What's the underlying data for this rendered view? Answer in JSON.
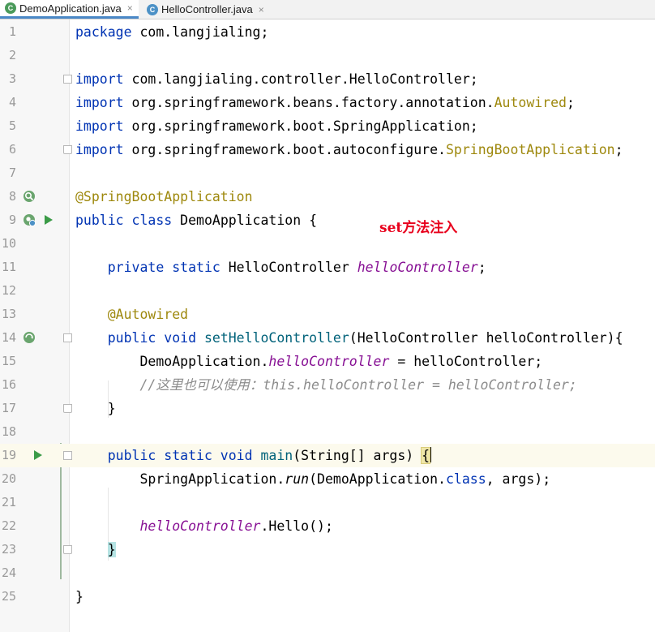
{
  "tabs": [
    {
      "label": "DemoApplication.java",
      "icon": "spring-class-icon",
      "active": true
    },
    {
      "label": "HelloController.java",
      "icon": "class-icon",
      "active": false
    }
  ],
  "tab_close_glyph": "×",
  "overlay_note": "set方法注入",
  "lines": {
    "l1": {
      "n": "1",
      "t1": "package",
      "t2": " com.langjialing;"
    },
    "l2": {
      "n": "2"
    },
    "l3": {
      "n": "3",
      "t1": "import",
      "t2": " com.langjialing.controller.HelloController;"
    },
    "l4": {
      "n": "4",
      "t1": "import",
      "t2": " org.springframework.beans.factory.annotation.",
      "t3": "Autowired",
      "t4": ";"
    },
    "l5": {
      "n": "5",
      "t1": "import",
      "t2": " org.springframework.boot.SpringApplication;"
    },
    "l6": {
      "n": "6",
      "t1": "import",
      "t2": " org.springframework.boot.autoconfigure.",
      "t3": "SpringBootApplication",
      "t4": ";"
    },
    "l7": {
      "n": "7"
    },
    "l8": {
      "n": "8",
      "t1": "@SpringBootApplication"
    },
    "l9": {
      "n": "9",
      "t1": "public class",
      "t2": " DemoApplication {"
    },
    "l10": {
      "n": "10"
    },
    "l11": {
      "n": "11",
      "t1": "    private static",
      "t2": " HelloController ",
      "t3": "helloController",
      "t4": ";"
    },
    "l12": {
      "n": "12"
    },
    "l13": {
      "n": "13",
      "t1": "    @Autowired"
    },
    "l14": {
      "n": "14",
      "t1": "    public void",
      "t2": " setHelloController",
      "t3": "(HelloController helloController){"
    },
    "l15": {
      "n": "15",
      "t1": "        DemoApplication.",
      "t2": "helloController",
      "t3": " = helloController;"
    },
    "l16": {
      "n": "16",
      "t1": "        //这里也可以使用：this.helloController = helloController;"
    },
    "l17": {
      "n": "17",
      "t1": "    }"
    },
    "l18": {
      "n": "18"
    },
    "l19": {
      "n": "19",
      "t1": "    public static void",
      "t2": " main",
      "t3": "(String[] args) ",
      "t4": "{"
    },
    "l20": {
      "n": "20",
      "t1": "        SpringApplication.",
      "t2": "run",
      "t3": "(DemoApplication.",
      "t4": "class",
      "t5": ", args);"
    },
    "l21": {
      "n": "21"
    },
    "l22": {
      "n": "22",
      "t1": "        helloController",
      "t2": ".Hello();"
    },
    "l23": {
      "n": "23",
      "t1": "    ",
      "t2": "}"
    },
    "l24": {
      "n": "24"
    },
    "l25": {
      "n": "25",
      "t1": "}"
    }
  },
  "colors": {
    "keyword": "#0033b3",
    "annotation": "#9e880d",
    "field": "#871094",
    "comment": "#8c8c8c",
    "note_red": "#e8001c",
    "run_green": "#3b9b47"
  }
}
